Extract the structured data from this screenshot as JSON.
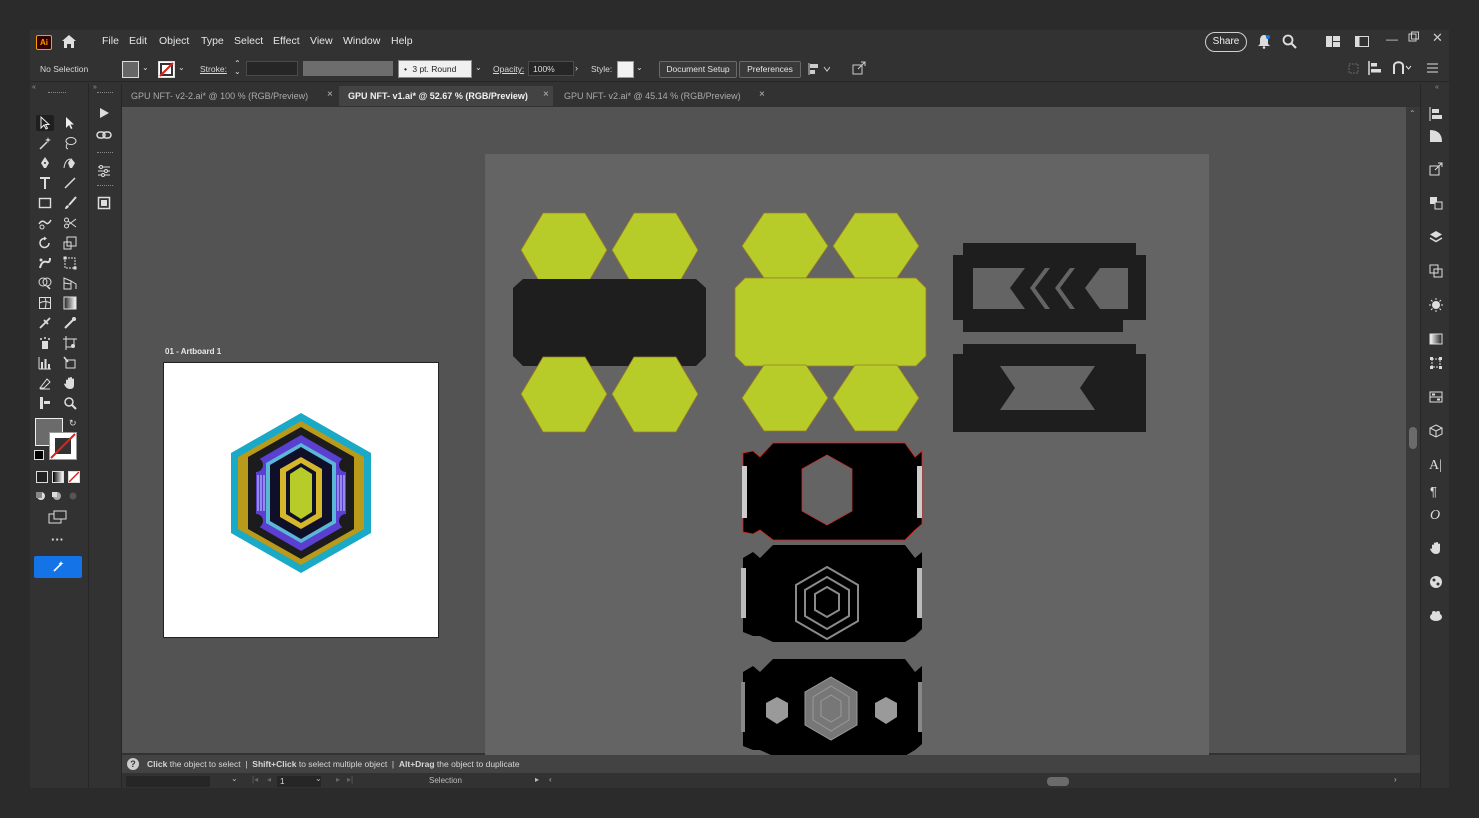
{
  "app": {
    "logo": "Ai",
    "home_icon": "home-icon"
  },
  "menu": [
    "File",
    "Edit",
    "Object",
    "Type",
    "Select",
    "Effect",
    "View",
    "Window",
    "Help"
  ],
  "topright": {
    "share_label": "Share"
  },
  "control": {
    "selection_status": "No Selection",
    "stroke_label": "Stroke:",
    "brush_label": "3 pt. Round",
    "opacity_label": "Opacity:",
    "opacity_value": "100%",
    "style_label": "Style:",
    "document_setup": "Document Setup",
    "preferences": "Preferences"
  },
  "tabs": [
    {
      "label": "GPU NFT- v2-2.ai* @ 100 % (RGB/Preview)",
      "active": false
    },
    {
      "label": "GPU NFT- v1.ai* @ 52.67 % (RGB/Preview)",
      "active": true
    },
    {
      "label": "GPU NFT- v2.ai* @ 45.14 % (RGB/Preview)",
      "active": false
    }
  ],
  "artboard": {
    "label": "01 - Artboard 1"
  },
  "status": {
    "click": "Click",
    "click_text": "the object to select",
    "shift_click": "Shift+Click",
    "shift_text": "to select multiple object",
    "alt_drag": "Alt+Drag",
    "alt_text": "the object to duplicate"
  },
  "bottom": {
    "page_number": "1",
    "mode": "Selection"
  },
  "colors": {
    "lime": "#b8cc29",
    "dark": "#1e1e1e",
    "accent_blue": "#1473e6",
    "gold": "#b99a1a",
    "teal": "#1aa9c6",
    "purple": "#5a3fd0"
  }
}
